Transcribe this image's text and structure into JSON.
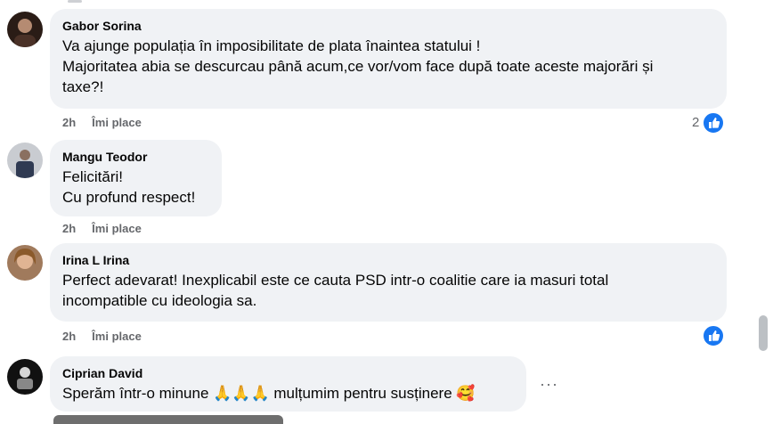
{
  "comments": [
    {
      "author": "Gabor Sorina",
      "lines": [
        "Va ajunge populația în imposibilitate de plata înaintea statului !",
        "Majoritatea abia se descurcau până acum,ce vor/vom face după toate aceste majorări și",
        "taxe?!"
      ],
      "time": "2h",
      "like_label": "Îmi place",
      "reaction_count": "2"
    },
    {
      "author": "Mangu Teodor",
      "lines": [
        "Felicitări!",
        "Cu profund respect!"
      ],
      "time": "2h",
      "like_label": "Îmi place"
    },
    {
      "author": "Irina L Irina",
      "lines": [
        "Perfect adevarat! Inexplicabil este ce cauta PSD intr-o coalitie care ia masuri total",
        "incompatible cu ideologia sa."
      ],
      "time": "2h",
      "like_label": "Îmi place"
    },
    {
      "author": "Ciprian David",
      "lines": [
        "Sperăm într-o minune 🙏🙏🙏 mulțumim pentru susținere 🥰"
      ],
      "more": "···"
    }
  ],
  "colors": {
    "bubble": "#f0f2f5",
    "like_blue": "#1877f2",
    "meta_gray": "#65676b"
  },
  "icons": [
    "avatar",
    "like-reaction-icon",
    "more-options-icon"
  ]
}
